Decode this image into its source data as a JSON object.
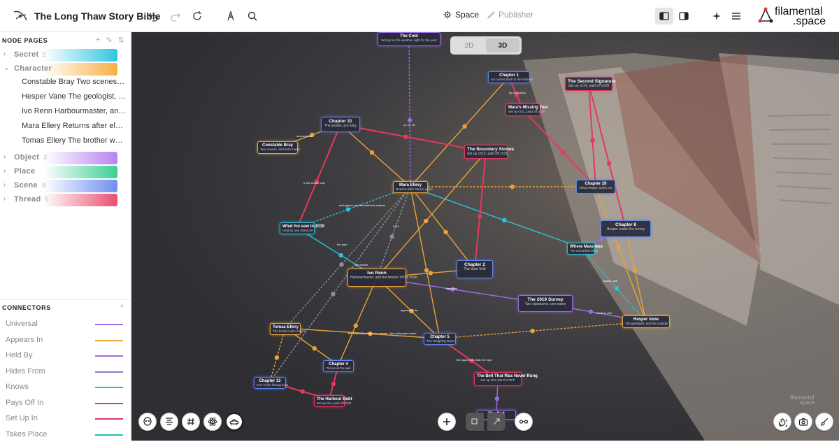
{
  "app": {
    "title": "The Long Thaw Story Bible"
  },
  "modes": {
    "space": "Space",
    "publisher": "Publisher"
  },
  "brand": {
    "line1": "filamental",
    "line2": ".space"
  },
  "sidebar": {
    "node_pages_title": "NODE PAGES",
    "categories": [
      {
        "name": "Secret",
        "count": "2",
        "color": "#31c6e0",
        "expanded": false
      },
      {
        "name": "Character",
        "count": "",
        "color": "#f6b040",
        "expanded": true
      },
      {
        "name": "Object",
        "count": "3",
        "color": "#b784f0",
        "expanded": false
      },
      {
        "name": "Place",
        "count": "",
        "color": "#3ccf93",
        "expanded": false
      },
      {
        "name": "Scene",
        "count": "8",
        "color": "#6f8ef0",
        "expanded": false
      },
      {
        "name": "Thread",
        "count": "5",
        "color": "#e8506d",
        "expanded": false
      }
    ],
    "character_items": [
      "Constable Bray Two scenes, ...",
      "Hesper Vane The geologist, a...",
      "Ivo Renn Harbourmaster, and...",
      "Mara Ellery Returns after elev...",
      "Tomas Ellery The brother who..."
    ],
    "connectors_title": "CONNECTORS",
    "connectors": [
      {
        "name": "Universal",
        "color": "#9b6be6"
      },
      {
        "name": "Appears In",
        "color": "#e9a33a"
      },
      {
        "name": "Held By",
        "color": "#a16ae0"
      },
      {
        "name": "Hides From",
        "color": "#8a7fc8"
      },
      {
        "name": "Knows",
        "color": "#29b8cc"
      },
      {
        "name": "Pays Off In",
        "color": "#e23a5c"
      },
      {
        "name": "Set Up In",
        "color": "#d8366a"
      },
      {
        "name": "Takes Place",
        "color": "#27bfa8"
      }
    ]
  },
  "view_toggle": {
    "opt2d": "2D",
    "opt3d": "3D"
  },
  "nodes": [
    {
      "id": "cold",
      "title": "The Cold",
      "subtitle": "Wrong for the weather, right for the year",
      "color": "purple"
    },
    {
      "id": "ch1",
      "title": "Chapter 1",
      "subtitle": "Ivo comes back to the harbour",
      "color": "blue"
    },
    {
      "id": "sig2",
      "title": "The Second Signature",
      "subtitle": "Set up ch14, paid off ch28",
      "color": "red"
    },
    {
      "id": "maras",
      "title": "Mara's Missing Year",
      "subtitle": "Set up ch11, paid off ch29",
      "color": "red"
    },
    {
      "id": "ch31",
      "title": "Chapter 31",
      "subtitle": "The stones, and why",
      "color": "blue"
    },
    {
      "id": "bray",
      "title": "Constable Bray",
      "subtitle": "Two scenes, and both matter",
      "color": "orange"
    },
    {
      "id": "stones",
      "title": "The Boundary Stones",
      "subtitle": "Set up ch12, paid off ch31",
      "color": "red"
    },
    {
      "id": "mara",
      "title": "Mara Ellery",
      "subtitle": "Returns after eleven years",
      "color": "orange"
    },
    {
      "id": "ch28",
      "title": "Chapter 28",
      "subtitle": "What Hesper works out",
      "color": "blue"
    },
    {
      "id": "ivosaw",
      "title": "What Ivo saw in 2019",
      "subtitle": "Held by one character",
      "color": "cyan"
    },
    {
      "id": "ch8",
      "title": "Chapter 8",
      "subtitle": "Hesper reads the survey",
      "color": "blue"
    },
    {
      "id": "wheremara",
      "title": "Where Mara was",
      "subtitle": "The unmarked thing",
      "color": "cyan"
    },
    {
      "id": "ch2",
      "title": "Chapter 2",
      "subtitle": "The thaw field",
      "color": "blue"
    },
    {
      "id": "ivo",
      "title": "Ivo Renn",
      "subtitle": "Harbourmaster, and the keeper of the room",
      "color": "orange"
    },
    {
      "id": "survey",
      "title": "The 2019 Survey",
      "subtitle": "Two signatures, one name",
      "color": "purple"
    },
    {
      "id": "hesper",
      "title": "Hesper Vane",
      "subtitle": "The geologist, and the outsider",
      "color": "orange"
    },
    {
      "id": "tomas",
      "title": "Tomas Ellery",
      "subtitle": "The brother who stayed",
      "color": "orange"
    },
    {
      "id": "ch5",
      "title": "Chapter 5",
      "subtitle": "The Weighing Room",
      "color": "blue"
    },
    {
      "id": "ch4",
      "title": "Chapter 4",
      "subtitle": "Tomas at the wall",
      "color": "blue"
    },
    {
      "id": "ch13",
      "title": "Chapter 13",
      "subtitle": "Ch7 in the fishing boat",
      "color": "blue"
    },
    {
      "id": "bell",
      "title": "The Bell That Was Never Rung",
      "subtitle": "Set up ch3, NO PAYOFF",
      "color": "red"
    },
    {
      "id": "harbour",
      "title": "The Harbour Debt",
      "subtitle": "Set up ch4, paid off ch21",
      "color": "red"
    },
    {
      "id": "bell2",
      "title": "The Bell",
      "subtitle": "",
      "color": "purple"
    }
  ],
  "edge_labels": [
    "ch 14, 28",
    "by production",
    "second chair",
    "in the reader only",
    "both grieve and the knife that matters",
    "2019",
    "the dark",
    "the reader",
    "signatory",
    "appears in the",
    "quarter, ch8",
    "needs it, ch8",
    "the shared the ferry one answer",
    "the unstamped name",
    "the paperwork stole the rope"
  ],
  "watermark": {
    "line1": "filamental",
    "line2": "space"
  }
}
